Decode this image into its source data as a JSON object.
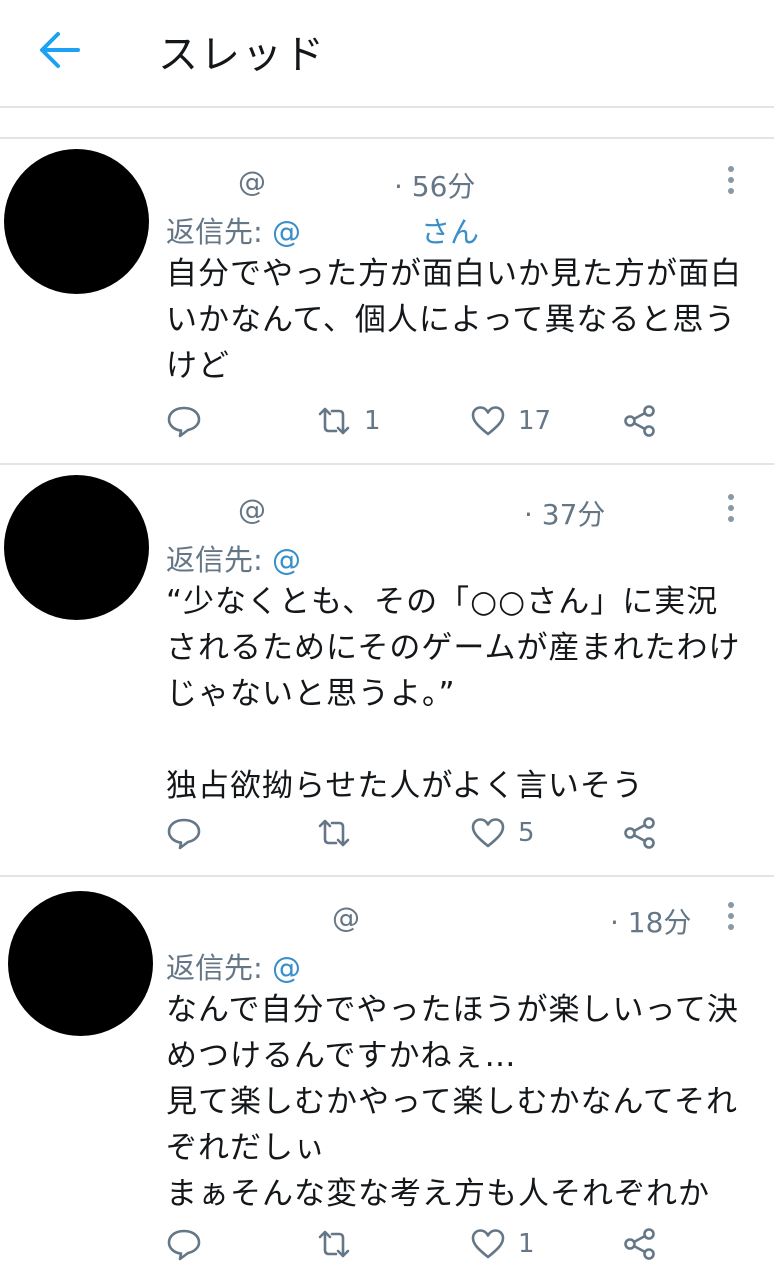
{
  "header": {
    "title": "スレッド"
  },
  "tweets": [
    {
      "at": "@",
      "time": "· 56分",
      "reply_label": "返信先:",
      "reply_handle": "@",
      "reply_suffix": "さん",
      "text": "自分でやった方が面白いか見た方が面白\nいかなんて、個人によって異なると思う\nけど",
      "retweets": "1",
      "likes": "17"
    },
    {
      "at": "@",
      "time": "· 37分",
      "reply_label": "返信先:",
      "reply_handle": "@",
      "text": "“少なくとも、その「○○さん」に実況\nされるためにそのゲームが産まれたわけ\nじゃないと思うよ。”\n\n独占欲拗らせた人がよく言いそう",
      "likes": "5"
    },
    {
      "at": "@",
      "time": "· 18分",
      "reply_label": "返信先:",
      "reply_handle": "@",
      "text": "なんで自分でやったほうが楽しいって決\nめつけるんですかねぇ…\n見て楽しむかやって楽しむかなんてそれ\nぞれだしぃ\nまぁそんな変な考え方も人それぞれか",
      "likes": "1"
    }
  ]
}
